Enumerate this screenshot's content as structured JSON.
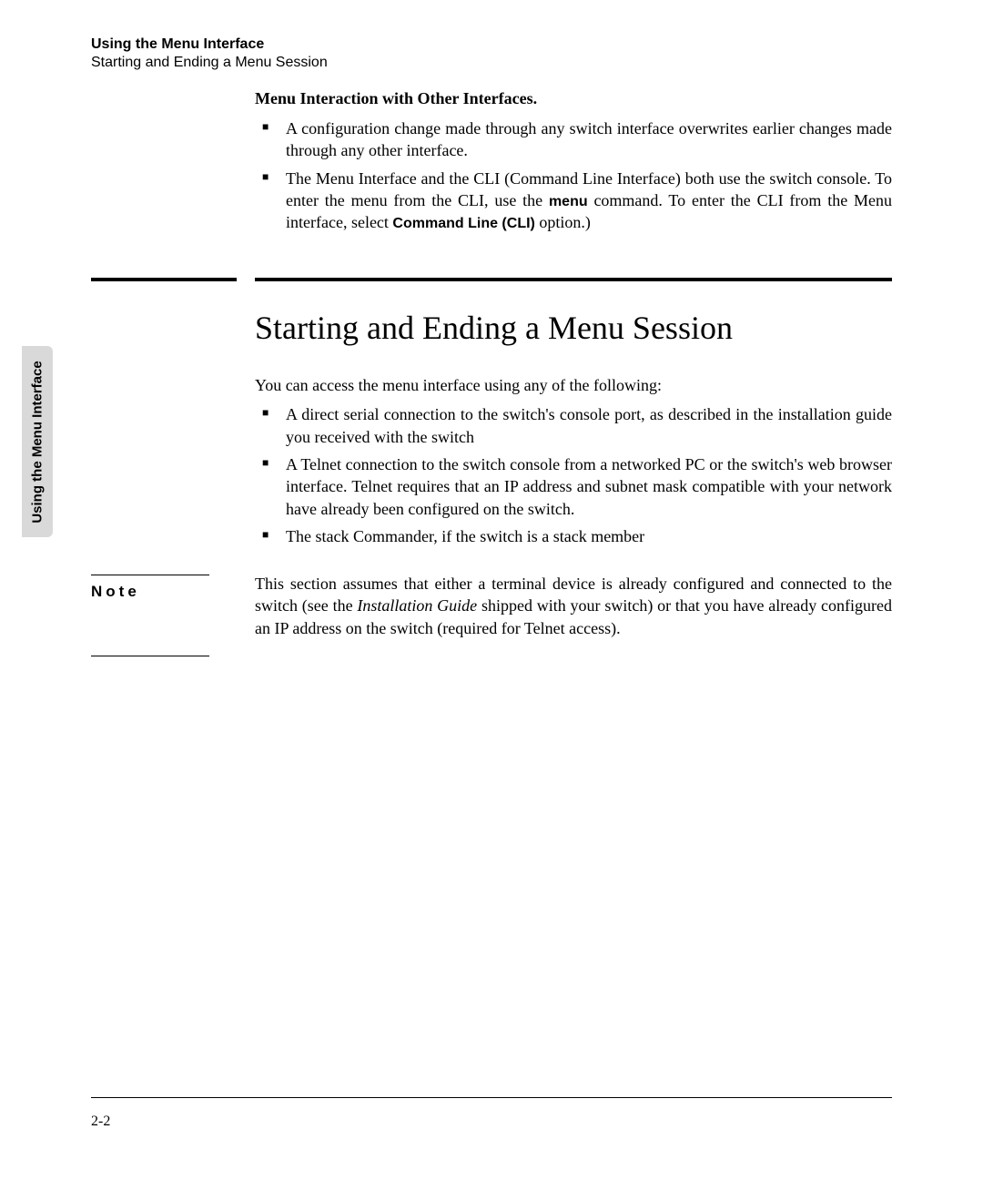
{
  "side_tab": "Using the Menu Interface",
  "header": {
    "title": "Using the Menu Interface",
    "subtitle": "Starting and Ending a Menu Session"
  },
  "top_section": {
    "subsection_title": "Menu Interaction with Other Interfaces.",
    "bullets": [
      {
        "text": "A configuration change made through any switch interface overwrites earlier changes made through any other interface."
      },
      {
        "pre1": "The Menu Interface and the CLI (Command Line Interface) both use the switch console. To enter the menu from the CLI, use the ",
        "bold1": "menu",
        "mid1": " command. To enter the CLI from the Menu interface, select ",
        "bold2": "Command Line (CLI)",
        "post1": " option.)"
      }
    ]
  },
  "main_section": {
    "heading": "Starting and Ending a Menu Session",
    "intro": "You can access the menu interface using any of the following:",
    "bullets": [
      "A direct serial connection to the switch's console port, as described in the installation guide you received with the switch",
      "A Telnet connection to the switch console from a networked PC or the switch's web browser interface. Telnet requires that an IP address and subnet mask compatible with your network have already been configured on the switch.",
      "The stack Commander, if the switch is a stack member"
    ]
  },
  "note": {
    "label": "Note",
    "body_pre": "This section assumes that either a terminal device is already configured and connected to the switch (see the ",
    "body_italic": "Installation Guide",
    "body_post": " shipped with your switch) or that you have already configured an IP address on the switch (required for Telnet access)."
  },
  "page_number": "2-2"
}
